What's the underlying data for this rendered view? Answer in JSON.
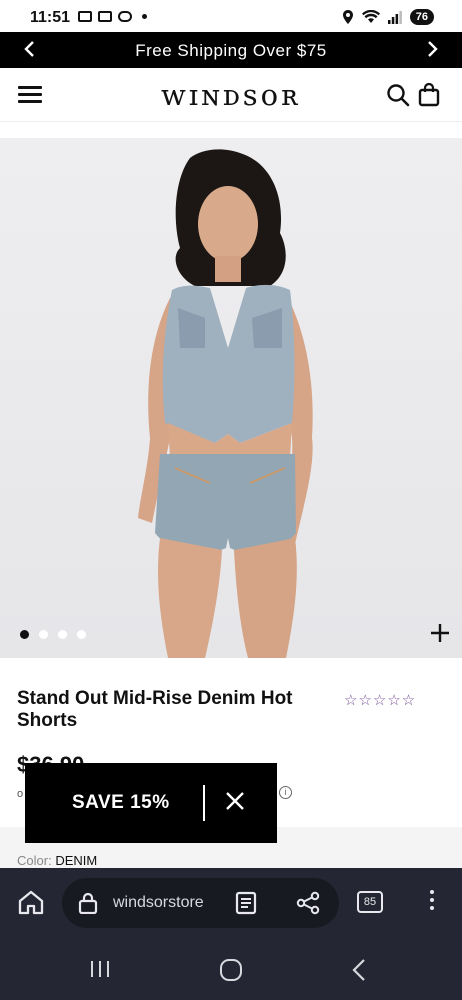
{
  "status_bar": {
    "time": "11:51",
    "battery": "76"
  },
  "promo": {
    "text": "Free Shipping Over $75",
    "prev_icon": "chevron-left-icon",
    "next_icon": "chevron-right-icon"
  },
  "header": {
    "logo": "WINDSOR",
    "menu_icon": "hamburger-icon",
    "search_icon": "search-icon",
    "bag_icon": "shopping-bag-icon"
  },
  "gallery": {
    "image_count": 4,
    "active_index": 0,
    "zoom_icon": "plus-icon"
  },
  "product": {
    "title": "Stand Out Mid-Rise Denim Hot Shorts",
    "rating_stars": "☆☆☆☆☆",
    "rating_value": 0,
    "price": "$36.90",
    "afterpay_fragment": "o",
    "color_label": "Color:",
    "color_value": "DENIM"
  },
  "save_popup": {
    "label": "SAVE 15%",
    "close_icon": "close-icon"
  },
  "browser": {
    "url": "windsorstore",
    "tab_count": "85"
  },
  "colors": {
    "promo_bg": "#000000",
    "star_color": "#7a4f96",
    "browser_bg": "#242733"
  }
}
